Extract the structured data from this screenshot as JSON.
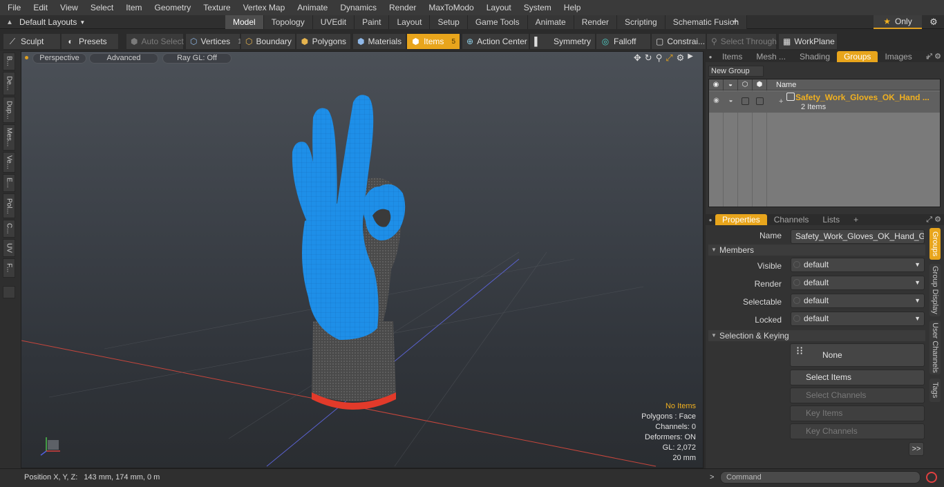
{
  "menu": [
    "File",
    "Edit",
    "View",
    "Select",
    "Item",
    "Geometry",
    "Texture",
    "Vertex Map",
    "Animate",
    "Dynamics",
    "Render",
    "MaxToModo",
    "Layout",
    "System",
    "Help"
  ],
  "layout_dropdown": "Default Layouts",
  "mode_tabs": [
    {
      "label": "Model",
      "active": true
    },
    {
      "label": "Topology"
    },
    {
      "label": "UVEdit"
    },
    {
      "label": "Paint"
    },
    {
      "label": "Layout"
    },
    {
      "label": "Setup"
    },
    {
      "label": "Game Tools"
    },
    {
      "label": "Animate"
    },
    {
      "label": "Render"
    },
    {
      "label": "Scripting"
    },
    {
      "label": "Schematic Fusion"
    }
  ],
  "only_label": "Only",
  "toolbar": {
    "sculpt": "Sculpt",
    "presets": "Presets",
    "auto_select": "Auto Select",
    "vertices": "Vertices",
    "vertices_count": "1",
    "boundary": "Boundary",
    "polygons": "Polygons",
    "materials": "Materials",
    "items": "Items",
    "items_count": "5",
    "action_center": "Action Center",
    "symmetry": "Symmetry",
    "falloff": "Falloff",
    "constraints": "Constrai...",
    "select_through": "Select Through",
    "workplane": "WorkPlane"
  },
  "left_strip": [
    "B...",
    "De...",
    "Dup...",
    "Mes...",
    "Ve...",
    "E...",
    "Pol...",
    "C...",
    "UV",
    "F..."
  ],
  "viewport": {
    "view": "Perspective",
    "shading": "Advanced",
    "raygl": "Ray GL: Off",
    "info": {
      "no_items": "No Items",
      "polygons": "Polygons : Face",
      "channels": "Channels: 0",
      "deformers": "Deformers: ON",
      "gl": "GL: 2,072",
      "scale": "20 mm"
    }
  },
  "top_panel_tabs": [
    {
      "label": "Items"
    },
    {
      "label": "Mesh ..."
    },
    {
      "label": "Shading"
    },
    {
      "label": "Groups",
      "active": true
    },
    {
      "label": "Images"
    }
  ],
  "groups": {
    "new_group": "New Group",
    "name_header": "Name",
    "row_name": "Safety_Work_Gloves_OK_Hand ...",
    "row_count": "2 Items"
  },
  "bottom_panel_tabs": [
    {
      "label": "Properties",
      "active": true
    },
    {
      "label": "Channels"
    },
    {
      "label": "Lists"
    }
  ],
  "properties": {
    "name_label": "Name",
    "name_value": "Safety_Work_Gloves_OK_Hand_Gesture",
    "members": "Members",
    "visible_label": "Visible",
    "visible_value": "default",
    "render_label": "Render",
    "render_value": "default",
    "selectable_label": "Selectable",
    "selectable_value": "default",
    "locked_label": "Locked",
    "locked_value": "default",
    "selection_keying": "Selection & Keying",
    "none_btn": "None",
    "select_items": "Select Items",
    "select_channels": "Select Channels",
    "key_items": "Key Items",
    "key_channels": "Key Channels",
    "more": ">>"
  },
  "vertical_tabs": [
    {
      "label": "Groups",
      "active": true
    },
    {
      "label": "Group Display"
    },
    {
      "label": "User Channels"
    },
    {
      "label": "Tags"
    }
  ],
  "status": {
    "position_label": "Position X, Y, Z:",
    "position_value": "143 mm, 174 mm, 0 m",
    "command_placeholder": "Command"
  },
  "colors": {
    "accent": "#e8a51c",
    "glove_blue": "#1e8fe8",
    "glove_knit": "#4a4a4a",
    "cuff_red": "#e23a2a"
  }
}
